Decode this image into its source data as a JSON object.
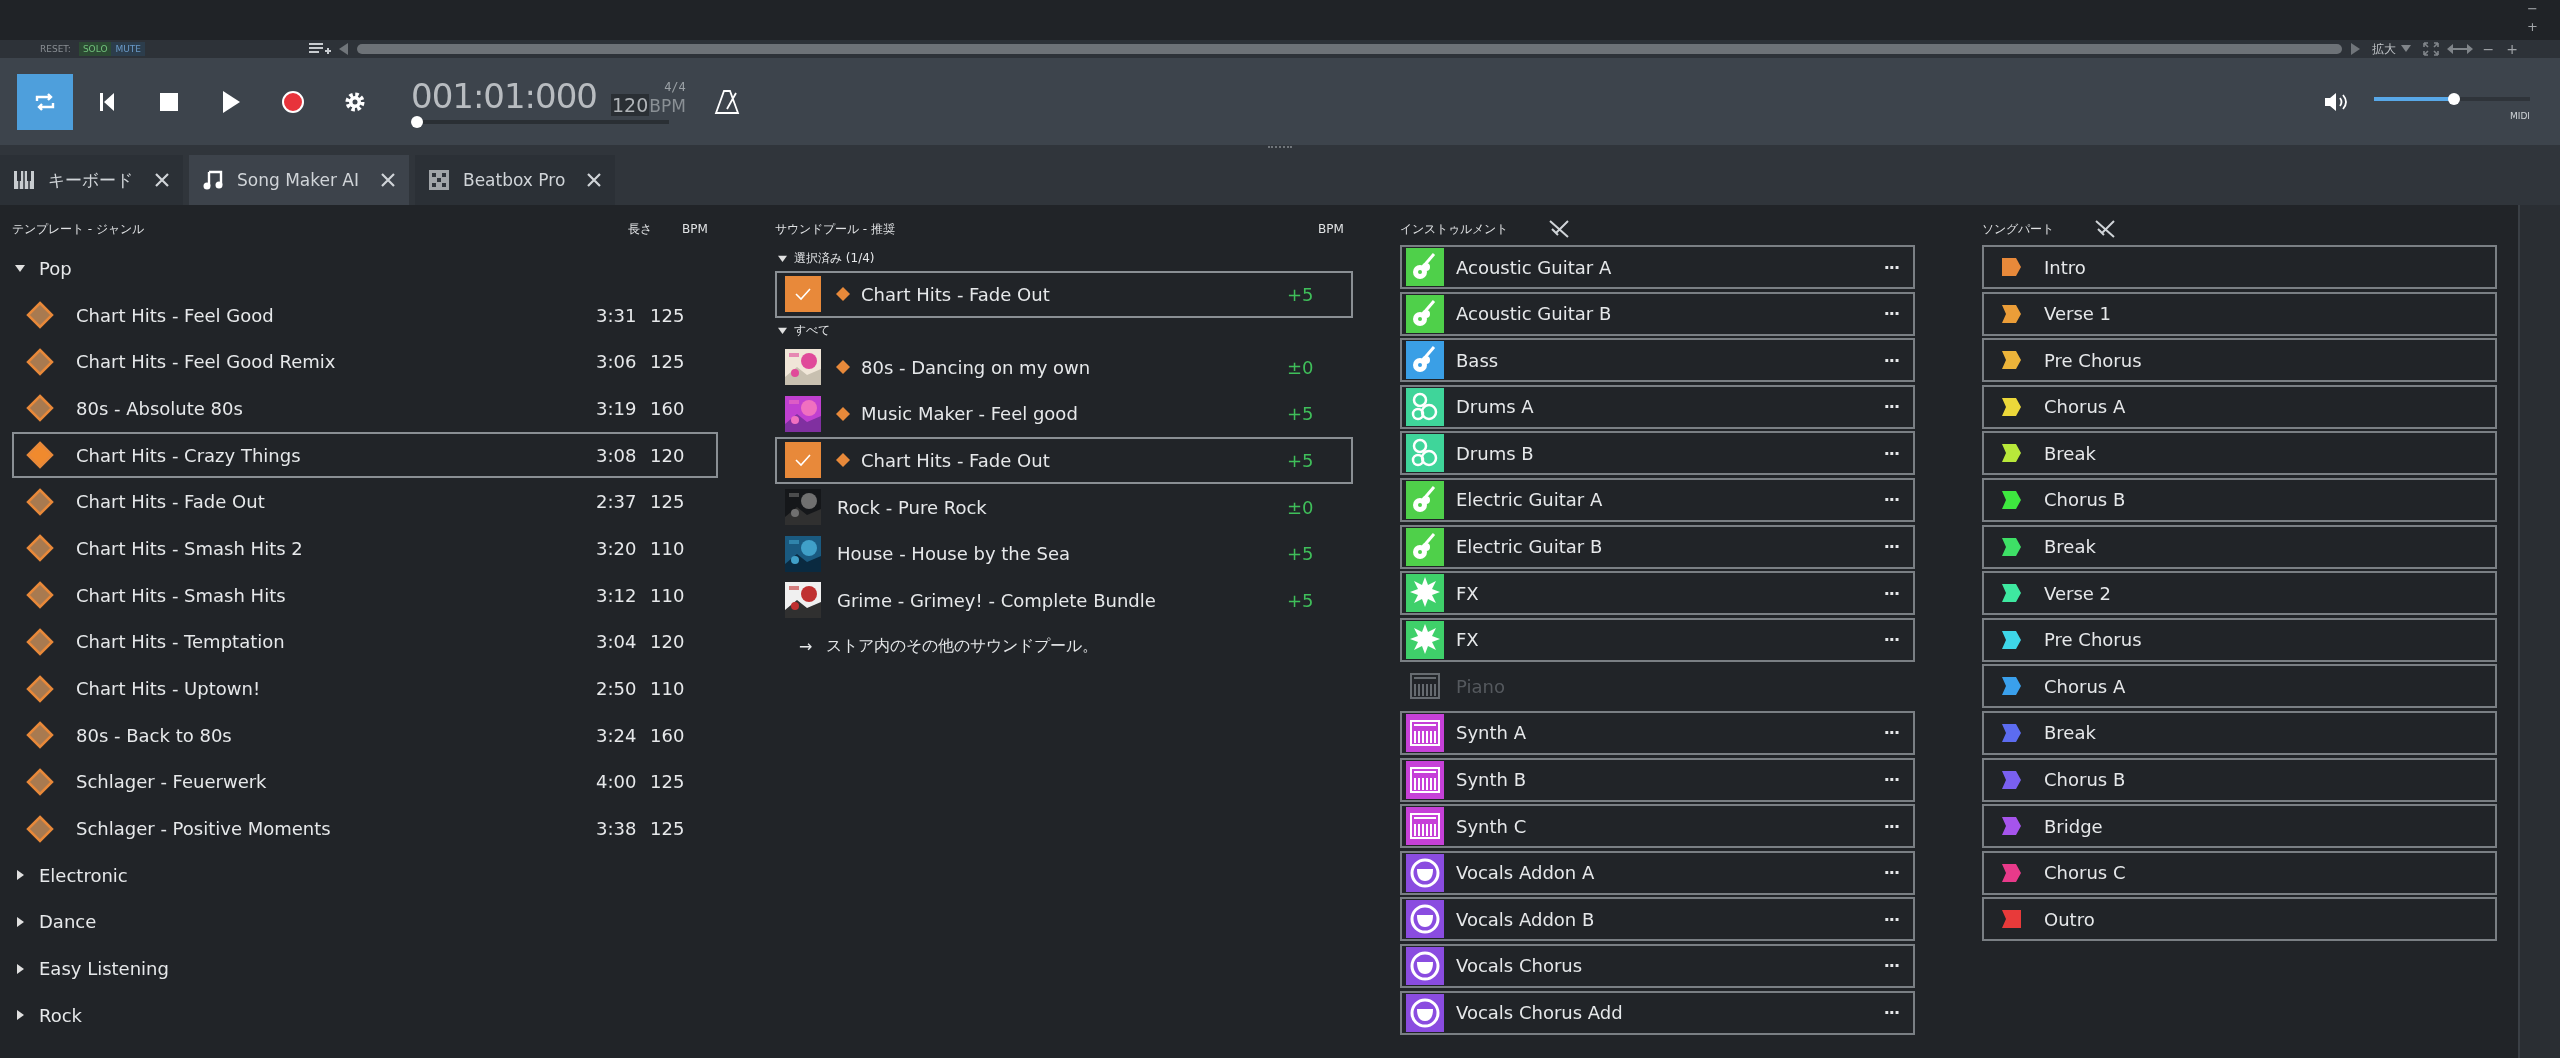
{
  "timeline_strip": {
    "reset_label": "RESET:",
    "solo": "SOLO",
    "mute": "MUTE",
    "zoom_label": "拡大",
    "zoom_out": "−",
    "zoom_in": "+",
    "corner_minus": "−",
    "corner_plus": "+"
  },
  "transport": {
    "loop_on": true,
    "time": "001:01:000",
    "signature": "4/4",
    "tempo": "120",
    "tempo_unit": "BPM",
    "position": {
      "level": 0
    },
    "volume": {
      "level": 0.51
    },
    "midi_label": "MIDI"
  },
  "tabs": [
    {
      "label": "キーボード",
      "selected": false
    },
    {
      "label": "Song Maker AI",
      "selected": true
    },
    {
      "label": "Beatbox Pro",
      "selected": false
    }
  ],
  "templates": {
    "header": "テンプレート - ジャンル",
    "length_header": "長さ",
    "bpm_header": "BPM",
    "genres": [
      {
        "name": "Pop",
        "expanded": true,
        "items": [
          {
            "title": "Chart Hits - Feel Good",
            "length": "3:31",
            "bpm": "125",
            "selected": false
          },
          {
            "title": "Chart Hits - Feel Good Remix",
            "length": "3:06",
            "bpm": "125",
            "selected": false
          },
          {
            "title": "80s - Absolute 80s",
            "length": "3:19",
            "bpm": "160",
            "selected": false
          },
          {
            "title": "Chart Hits - Crazy Things",
            "length": "3:08",
            "bpm": "120",
            "selected": true
          },
          {
            "title": "Chart Hits - Fade Out",
            "length": "2:37",
            "bpm": "125",
            "selected": false
          },
          {
            "title": "Chart Hits - Smash Hits 2",
            "length": "3:20",
            "bpm": "110",
            "selected": false
          },
          {
            "title": "Chart Hits - Smash Hits",
            "length": "3:12",
            "bpm": "110",
            "selected": false
          },
          {
            "title": "Chart Hits - Temptation",
            "length": "3:04",
            "bpm": "120",
            "selected": false
          },
          {
            "title": "Chart Hits - Uptown!",
            "length": "2:50",
            "bpm": "110",
            "selected": false
          },
          {
            "title": "80s - Back to 80s",
            "length": "3:24",
            "bpm": "160",
            "selected": false
          },
          {
            "title": "Schlager - Feuerwerk",
            "length": "4:00",
            "bpm": "125",
            "selected": false
          },
          {
            "title": "Schlager - Positive Moments",
            "length": "3:38",
            "bpm": "125",
            "selected": false
          }
        ]
      },
      {
        "name": "Electronic",
        "expanded": false
      },
      {
        "name": "Dance",
        "expanded": false
      },
      {
        "name": "Easy Listening",
        "expanded": false
      },
      {
        "name": "Rock",
        "expanded": false
      }
    ]
  },
  "soundpools": {
    "header": "サウンドプール - 推奨",
    "bpm_header": "BPM",
    "groups": [
      {
        "name": "選択済み (1/4)",
        "expanded": true,
        "items": [
          {
            "title": "Chart Hits - Fade Out",
            "bpm": "+5",
            "checked": true,
            "marked": true,
            "selected": true
          }
        ]
      },
      {
        "name": "すべて",
        "expanded": true,
        "items": [
          {
            "title": "80s - Dancing on my own",
            "bpm": "±0",
            "checked": false,
            "marked": true,
            "selected": false
          },
          {
            "title": "Music Maker - Feel good",
            "bpm": "+5",
            "checked": false,
            "marked": true,
            "selected": false
          },
          {
            "title": "Chart Hits - Fade Out",
            "bpm": "+5",
            "checked": true,
            "marked": true,
            "selected": true
          },
          {
            "title": "Rock - Pure Rock",
            "bpm": "±0",
            "checked": false,
            "marked": false,
            "selected": false
          },
          {
            "title": "House - House by the Sea",
            "bpm": "+5",
            "checked": false,
            "marked": false,
            "selected": false
          },
          {
            "title": "Grime - Grimey! - Complete Bundle",
            "bpm": "+5",
            "checked": false,
            "marked": false,
            "selected": false
          }
        ]
      }
    ],
    "store_arrow": "→",
    "store_link": "ストア内のその他のサウンドプール。"
  },
  "instruments": {
    "header": "インストゥルメント",
    "menu_glyph": "···",
    "items": [
      {
        "name": "Acoustic Guitar A",
        "kind": "guitar",
        "disabled": false
      },
      {
        "name": "Acoustic Guitar B",
        "kind": "guitar",
        "disabled": false
      },
      {
        "name": "Bass",
        "kind": "bass",
        "disabled": false
      },
      {
        "name": "Drums A",
        "kind": "drums",
        "disabled": false
      },
      {
        "name": "Drums B",
        "kind": "drums",
        "disabled": false
      },
      {
        "name": "Electric Guitar A",
        "kind": "guitar",
        "disabled": false
      },
      {
        "name": "Electric Guitar B",
        "kind": "guitar",
        "disabled": false
      },
      {
        "name": "FX",
        "kind": "fx",
        "disabled": false
      },
      {
        "name": "FX",
        "kind": "fx",
        "disabled": false
      },
      {
        "name": "Piano",
        "kind": "piano",
        "disabled": true
      },
      {
        "name": "Synth A",
        "kind": "synth",
        "disabled": false
      },
      {
        "name": "Synth B",
        "kind": "synth",
        "disabled": false
      },
      {
        "name": "Synth C",
        "kind": "synth",
        "disabled": false
      },
      {
        "name": "Vocals Addon A",
        "kind": "vocals",
        "disabled": false
      },
      {
        "name": "Vocals Addon B",
        "kind": "vocals",
        "disabled": false
      },
      {
        "name": "Vocals Chorus",
        "kind": "vocals",
        "disabled": false
      },
      {
        "name": "Vocals Chorus Add",
        "kind": "vocals",
        "disabled": false
      }
    ]
  },
  "song_parts": {
    "header": "ソングパート",
    "items": [
      {
        "name": "Intro",
        "color": "#e8893a"
      },
      {
        "name": "Verse 1",
        "color": "#eb9d38"
      },
      {
        "name": "Pre Chorus",
        "color": "#ecb43a"
      },
      {
        "name": "Chorus A",
        "color": "#ecd83a"
      },
      {
        "name": "Break",
        "color": "#b8e83a"
      },
      {
        "name": "Chorus B",
        "color": "#3ee83f"
      },
      {
        "name": "Break",
        "color": "#3ee066"
      },
      {
        "name": "Verse 2",
        "color": "#3ee8a0"
      },
      {
        "name": "Pre Chorus",
        "color": "#3ed6e8"
      },
      {
        "name": "Chorus A",
        "color": "#3aa0ec"
      },
      {
        "name": "Break",
        "color": "#5c6cf0"
      },
      {
        "name": "Chorus B",
        "color": "#7a60f0"
      },
      {
        "name": "Bridge",
        "color": "#a654ec"
      },
      {
        "name": "Chorus C",
        "color": "#e83a8a"
      },
      {
        "name": "Outro",
        "color": "#e83a3a"
      }
    ]
  }
}
